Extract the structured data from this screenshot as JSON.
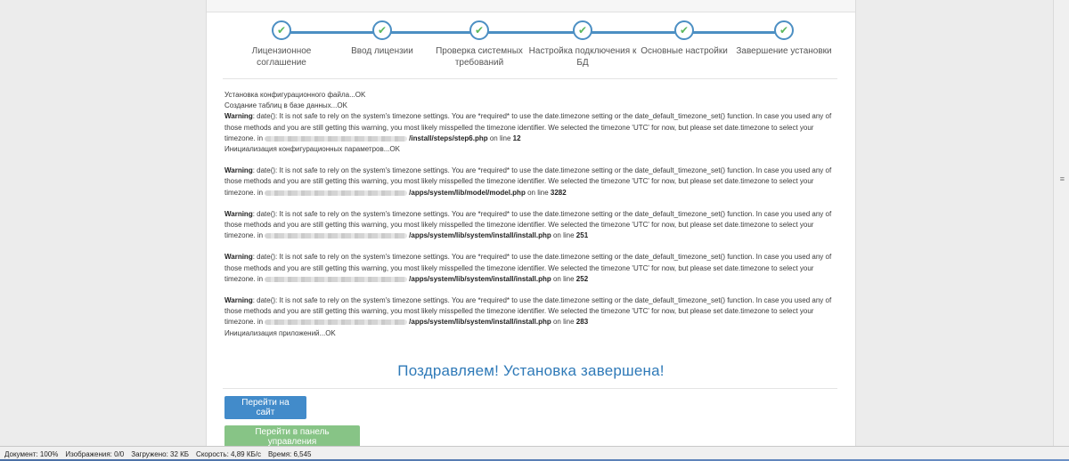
{
  "steps": [
    {
      "label": "Лицензионное соглашение",
      "done": true
    },
    {
      "label": "Ввод лицензии",
      "done": true
    },
    {
      "label": "Проверка системных требований",
      "done": true
    },
    {
      "label": "Настройка подключения к БД",
      "done": true
    },
    {
      "label": "Основные настройки",
      "done": true
    },
    {
      "label": "Завершение установки",
      "done": true
    }
  ],
  "log": {
    "line_config": "Установка конфигурационного файла...OK",
    "line_tables": "Создание таблиц в базе данных...OK",
    "warning_label": "Warning",
    "warning_text": ": date(): It is not safe to rely on the system's timezone settings. You are *required* to use the date.timezone setting or the date_default_timezone_set() function. In case you used any of those methods and you are still getting this warning, you most likely misspelled the timezone identifier. We selected the timezone 'UTC' for now, but please set date.timezone to select your timezone. in",
    "on_line": "on line",
    "warnings": [
      {
        "file": "/install/steps/step6.php",
        "line": "12",
        "after": "Инициализация конфигурационных параметров...OK"
      },
      {
        "file": "/apps/system/lib/model/model.php",
        "line": "3282",
        "after": ""
      },
      {
        "file": "/apps/system/lib/system/install/install.php",
        "line": "251",
        "after": ""
      },
      {
        "file": "/apps/system/lib/system/install/install.php",
        "line": "252",
        "after": ""
      },
      {
        "file": "/apps/system/lib/system/install/install.php",
        "line": "283",
        "after": "Инициализация приложений...OK"
      }
    ]
  },
  "congrats": "Поздравляем! Установка завершена!",
  "buttons": {
    "go_site": "Перейти на сайт",
    "go_admin": "Перейти в панель управления"
  },
  "statusbar": {
    "document": "Документ: 100%",
    "images": "Изображения: 0/0",
    "loaded": "Загружено: 32 КБ",
    "speed": "Скорость: 4,89 КБ/с",
    "time": "Время: 6,545"
  },
  "colors": {
    "accent": "#428bca",
    "success": "#5cb85c",
    "congrats": "#2f7ab8"
  }
}
